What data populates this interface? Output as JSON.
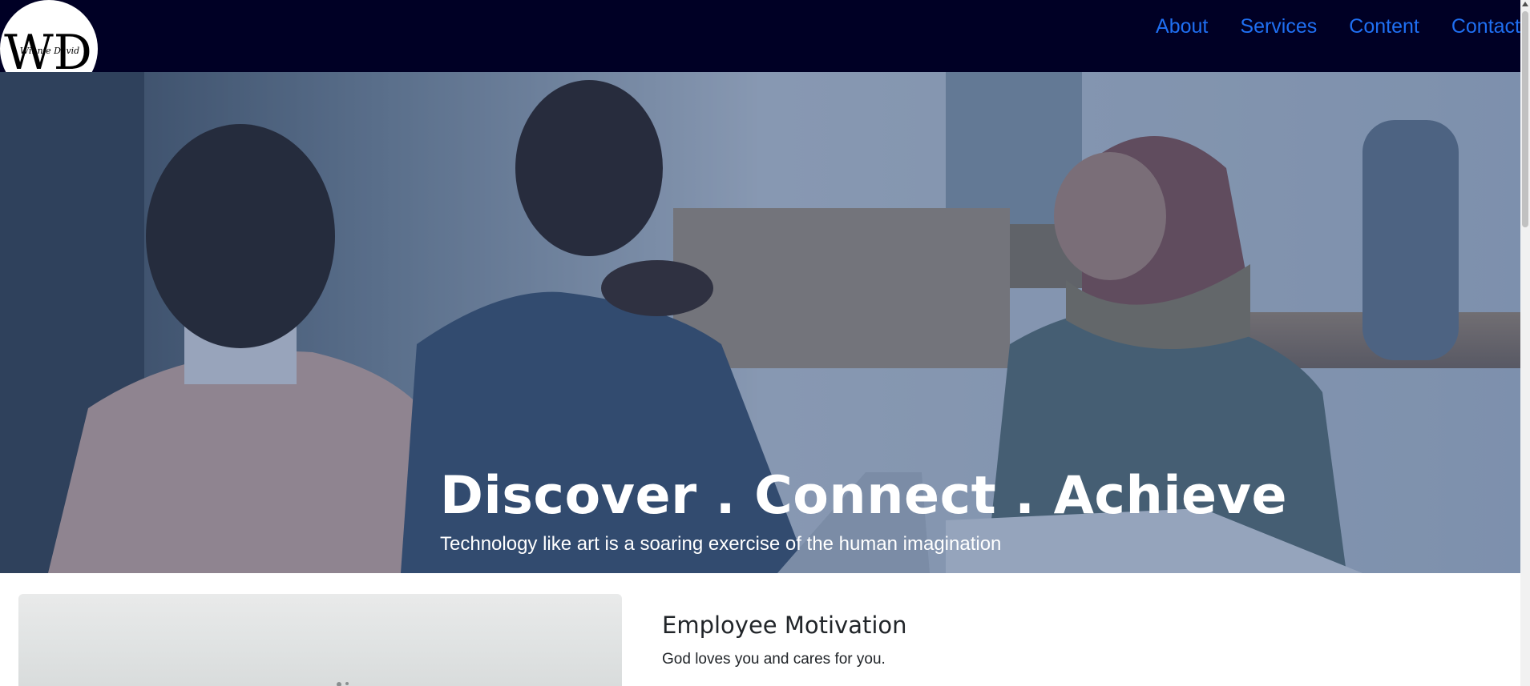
{
  "navbar": {
    "logo_initials": "WD",
    "logo_script": "Winnie David",
    "links": [
      "About",
      "Services",
      "Content",
      "Contact"
    ]
  },
  "hero": {
    "title": "Discover . Connect . Achieve",
    "subtitle": "Technology like art is a soaring exercise of the human imagination"
  },
  "section": {
    "title": "Employee Motivation",
    "text": "God loves you and cares for you."
  },
  "colors": {
    "navbar_bg": "#000025",
    "nav_link": "#1f6ff2",
    "hero_overlay": "#1c3a6e"
  }
}
